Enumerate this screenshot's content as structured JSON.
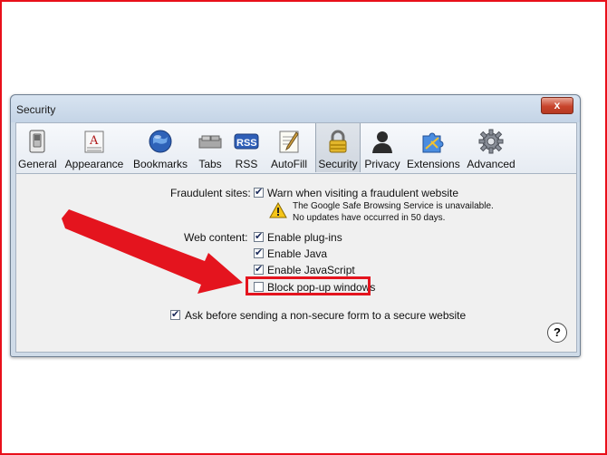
{
  "window": {
    "title": "Security",
    "close_label": "x"
  },
  "toolbar": {
    "items": [
      {
        "label": "General",
        "icon": "switch-icon"
      },
      {
        "label": "Appearance",
        "icon": "font-icon"
      },
      {
        "label": "Bookmarks",
        "icon": "globe-icon"
      },
      {
        "label": "Tabs",
        "icon": "tabs-icon"
      },
      {
        "label": "RSS",
        "icon": "rss-icon"
      },
      {
        "label": "AutoFill",
        "icon": "pen-icon"
      },
      {
        "label": "Security",
        "icon": "lock-icon",
        "selected": true
      },
      {
        "label": "Privacy",
        "icon": "person-icon"
      },
      {
        "label": "Extensions",
        "icon": "puzzle-icon"
      },
      {
        "label": "Advanced",
        "icon": "gear-icon"
      }
    ]
  },
  "security": {
    "fraudulent_sites_label": "Fraudulent sites:",
    "warn_fraudulent": {
      "label": "Warn when visiting a fraudulent website",
      "checked": true
    },
    "warning_line1": "The Google Safe Browsing Service is unavailable.",
    "warning_line2": "No updates have occurred in 50 days.",
    "web_content_label": "Web content:",
    "enable_plugins": {
      "label": "Enable plug-ins",
      "checked": true
    },
    "enable_java": {
      "label": "Enable Java",
      "checked": true
    },
    "enable_javascript": {
      "label": "Enable JavaScript",
      "checked": true
    },
    "block_popups": {
      "label": "Block pop-up windows",
      "checked": false
    },
    "ask_nonsecure": {
      "label": "Ask before sending a non-secure form to a secure website",
      "checked": true
    },
    "help_label": "?"
  },
  "colors": {
    "annotation_red": "#e4141e",
    "window_frame": "#cfdbe8"
  }
}
